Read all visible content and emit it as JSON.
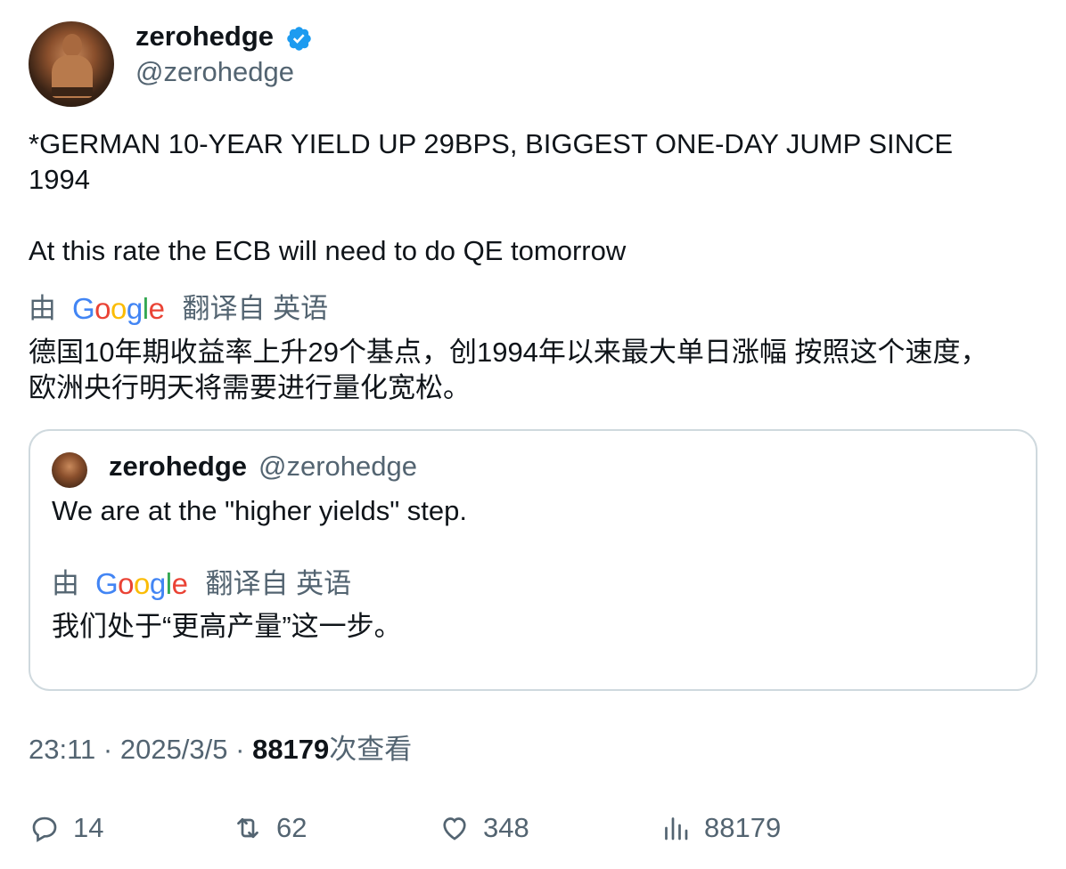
{
  "author": {
    "name": "zerohedge",
    "handle": "@zerohedge",
    "verified_color": "#1d9bf0"
  },
  "tweet": {
    "line1": "*GERMAN 10-YEAR YIELD UP 29BPS, BIGGEST ONE-DAY JUMP SINCE",
    "line2": "1994",
    "line3": "At this rate the ECB will need to do QE tomorrow"
  },
  "translate_bar": {
    "by": "由",
    "google": [
      "G",
      "o",
      "o",
      "g",
      "l",
      "e"
    ],
    "from": "翻译自 英语"
  },
  "translation": {
    "line1": "德国10年期收益率上升29个基点，创1994年以来最大单日涨幅 按照这个速度，",
    "line2": "欧洲央行明天将需要进行量化宽松。"
  },
  "quoted": {
    "name": "zerohedge",
    "handle": "@zerohedge",
    "text": "We are at the \"higher yields\" step.",
    "translation": "我们处于“更高产量”这一步。"
  },
  "meta": {
    "time": "23:11",
    "sep1": " · ",
    "date": "2025/3/5",
    "sep2": " · ",
    "views": "88179",
    "views_label": "次查看"
  },
  "actions": {
    "replies": "14",
    "reposts": "62",
    "likes": "348",
    "views": "88179"
  }
}
